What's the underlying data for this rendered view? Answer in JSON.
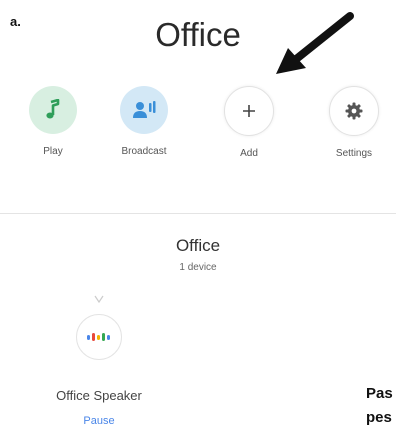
{
  "figure_label": "a.",
  "room_title": "Office",
  "actions": [
    {
      "label": "Play",
      "icon": "music-note-icon"
    },
    {
      "label": "Broadcast",
      "icon": "broadcast-icon"
    },
    {
      "label": "Add",
      "icon": "plus-icon"
    },
    {
      "label": "Settings",
      "icon": "gear-icon"
    }
  ],
  "room": {
    "name": "Office",
    "device_count": "1 device"
  },
  "device": {
    "name": "Office Speaker",
    "action": "Pause",
    "icon": "speaker-dots-icon"
  },
  "side_text": [
    "Pas",
    "pes"
  ],
  "colors": {
    "accent": "#4a86e8",
    "play_bg": "#d8efe1",
    "broadcast_bg": "#d3e8f6",
    "play_icon": "#2f9e5a",
    "broadcast_icon": "#3a8fd8"
  }
}
